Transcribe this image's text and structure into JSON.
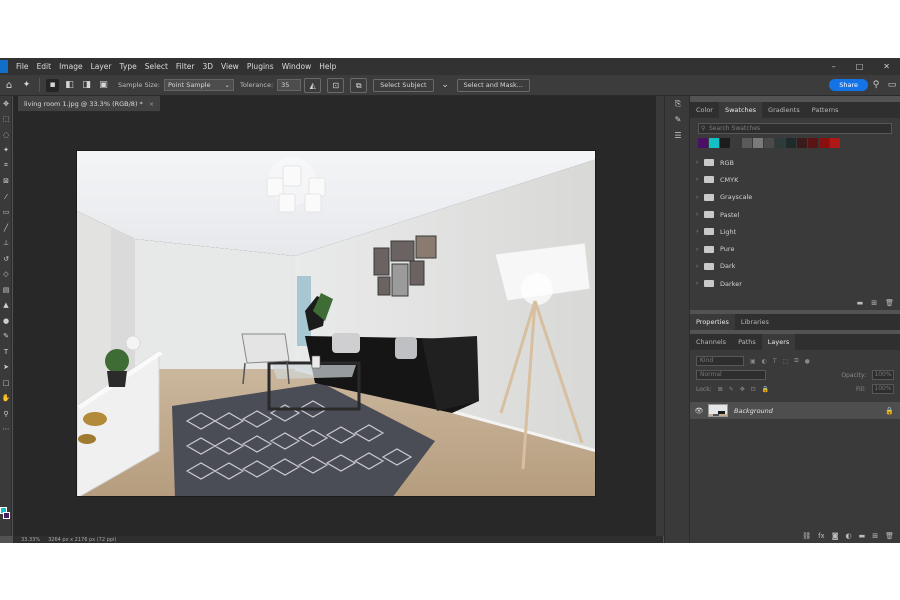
{
  "menu": [
    "File",
    "Edit",
    "Image",
    "Layer",
    "Type",
    "Select",
    "Filter",
    "3D",
    "View",
    "Plugins",
    "Window",
    "Help"
  ],
  "window_controls": [
    "–",
    "□",
    "✕"
  ],
  "options": {
    "sample_size_label": "Sample Size:",
    "sample_size_value": "Point Sample",
    "tolerance_label": "Tolerance:",
    "tolerance_value": "35",
    "select_subject": "Select Subject",
    "select_and_mask": "Select and Mask...",
    "share": "Share"
  },
  "document": {
    "tab_title": "living room 1.jpg @ 33.3% (RGB/8) *",
    "zoom": "33.33%",
    "size": "3264 px x 2176 px (72 ppi)"
  },
  "colors": {
    "foreground": "#12c0c6",
    "background": "#4a1c66",
    "accent": "#1473e6"
  },
  "swatches_panel": {
    "tabs": [
      "Color",
      "Swatches",
      "Gradients",
      "Patterns"
    ],
    "active_tab": "Swatches",
    "search_placeholder": "Search Swatches",
    "recent": [
      "#4b1066",
      "#12c0c6",
      "#1d1d1d",
      "#3b3b3b",
      "#5a5a5a",
      "#7a7a7a",
      "#4a4a4a",
      "#2d3b3b",
      "#1f2a2a",
      "#3a1a1a",
      "#5a1414",
      "#8a1010",
      "#b01818"
    ],
    "folders": [
      "RGB",
      "CMYK",
      "Grayscale",
      "Pastel",
      "Light",
      "Pure",
      "Dark",
      "Darker"
    ]
  },
  "properties_panel": {
    "tabs": [
      "Properties",
      "Libraries"
    ]
  },
  "layers_panel": {
    "tabs": [
      "Channels",
      "Paths",
      "Layers"
    ],
    "active_tab": "Layers",
    "kind": "Kind",
    "blend_mode": "Normal",
    "opacity_label": "Opacity:",
    "opacity_value": "100%",
    "lock_label": "Lock:",
    "fill_label": "Fill:",
    "fill_value": "100%",
    "layers": [
      {
        "name": "Background",
        "visible": true,
        "locked": true
      }
    ]
  }
}
